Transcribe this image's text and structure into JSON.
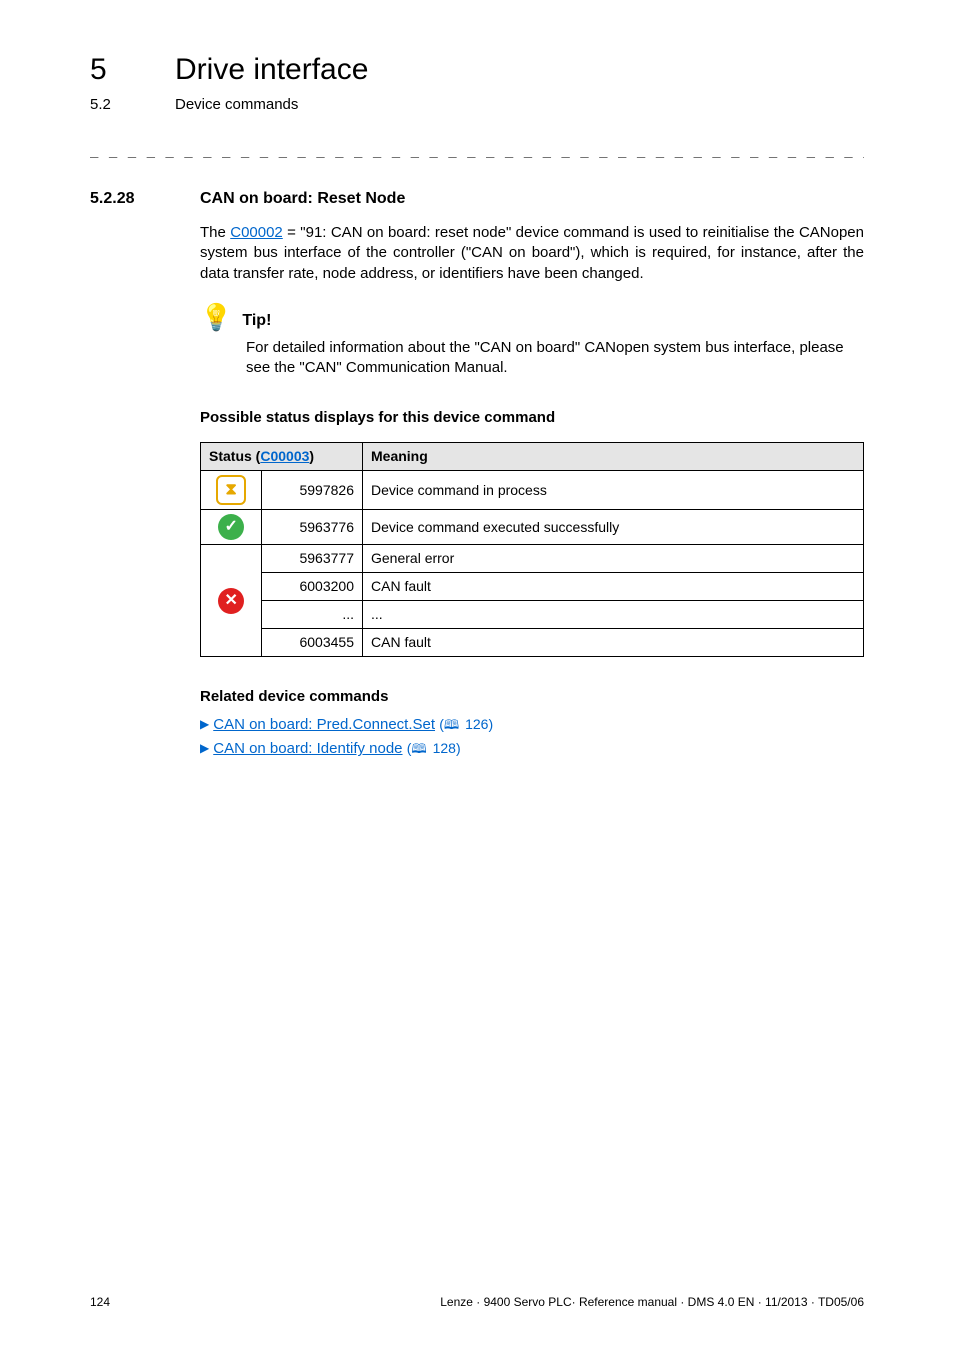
{
  "header": {
    "chapter_num": "5",
    "chapter_title": "Drive interface",
    "sub_num": "5.2",
    "sub_title": "Device commands"
  },
  "dashes": "_ _ _ _ _ _ _ _ _ _ _ _ _ _ _ _ _ _ _ _ _ _ _ _ _ _ _ _ _ _ _ _ _ _ _ _ _ _ _ _ _ _ _ _ _ _ _ _ _ _ _ _ _ _ _ _ _ _ _ _ _ _ _ _",
  "section": {
    "num": "5.2.28",
    "title": "CAN on board: Reset Node"
  },
  "intro": {
    "pre": "The ",
    "code_link": "C00002",
    "post": " = \"91: CAN on board: reset node\" device command is used to reinitialise the CANopen system bus interface of the controller (\"CAN on board\"), which is required, for instance, after the data transfer rate, node address, or identifiers have been changed."
  },
  "tip": {
    "label": "Tip!",
    "text": "For detailed information about the \"CAN on board\" CANopen system bus interface, please see the \"CAN\" Communication Manual."
  },
  "status_heading": "Possible status displays for this device command",
  "table": {
    "header": {
      "status_pre": "Status (",
      "status_link": "C00003",
      "status_post": ")",
      "meaning": "Meaning"
    },
    "groups": [
      {
        "icon": "wait",
        "rows": [
          {
            "value": "5997826",
            "meaning": "Device command in process"
          }
        ]
      },
      {
        "icon": "ok",
        "rows": [
          {
            "value": "5963776",
            "meaning": "Device command executed successfully"
          }
        ]
      },
      {
        "icon": "err",
        "rows": [
          {
            "value": "5963777",
            "meaning": "General error"
          },
          {
            "value": "6003200",
            "meaning": "CAN fault"
          },
          {
            "value": "...",
            "meaning": "..."
          },
          {
            "value": "6003455",
            "meaning": "CAN fault"
          }
        ]
      }
    ]
  },
  "related_heading": "Related device commands",
  "related": [
    {
      "label": "CAN on board: Pred.Connect.Set",
      "page": "126"
    },
    {
      "label": "CAN on board: Identify node",
      "page": "128"
    }
  ],
  "footer": {
    "page": "124",
    "ref": "Lenze · 9400 Servo PLC· Reference manual · DMS 4.0 EN · 11/2013 · TD05/06"
  }
}
